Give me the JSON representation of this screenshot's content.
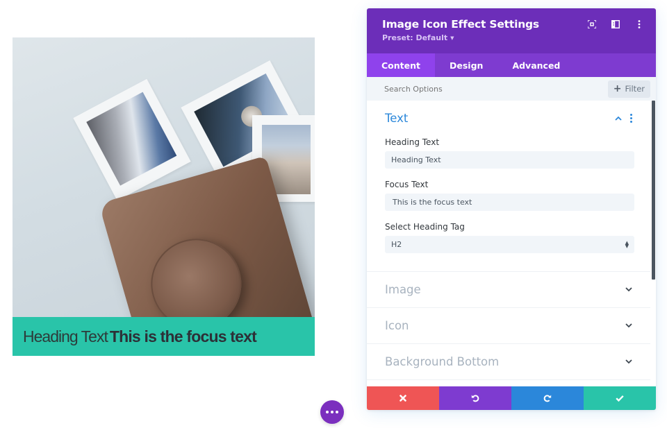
{
  "preview": {
    "heading_text": "Heading Text",
    "focus_text": "This is the focus text",
    "caption_bg": "#29c4a9"
  },
  "more_button": {
    "label": "More options",
    "color": "#7b2fbe"
  },
  "panel": {
    "title": "Image Icon Effect Settings",
    "preset_label": "Preset: Default",
    "header_icons": [
      "focus-mode-icon",
      "split-view-icon",
      "more-vertical-icon"
    ],
    "tabs": [
      {
        "label": "Content",
        "active": true
      },
      {
        "label": "Design",
        "active": false
      },
      {
        "label": "Advanced",
        "active": false
      }
    ],
    "search": {
      "placeholder": "Search Options",
      "value": ""
    },
    "filter_label": "Filter",
    "sections": [
      {
        "title": "Text",
        "open": true,
        "fields": [
          {
            "label": "Heading Text",
            "value": "Heading Text",
            "type": "text"
          },
          {
            "label": "Focus Text",
            "value": "This is the focus text",
            "type": "text"
          },
          {
            "label": "Select Heading Tag",
            "value": "H2",
            "type": "select"
          }
        ]
      },
      {
        "title": "Image",
        "open": false
      },
      {
        "title": "Icon",
        "open": false
      },
      {
        "title": "Background Bottom",
        "open": false
      }
    ],
    "footer": {
      "cancel": "Discard changes",
      "undo": "Undo",
      "redo": "Redo",
      "save": "Save changes"
    },
    "colors": {
      "header": "#6c2eb9",
      "tabs": "#7e3bd0",
      "active_tab": "#8f42ec",
      "accent_blue": "#2b87da",
      "cancel": "#ef5555",
      "undo": "#7e3bd0",
      "redo": "#2b87da",
      "save": "#29c4a9"
    }
  }
}
